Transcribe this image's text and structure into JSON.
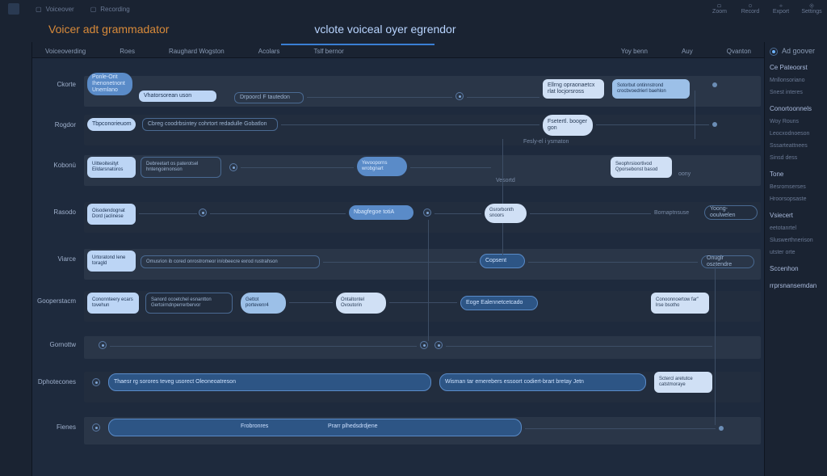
{
  "topbar": {
    "tabs": [
      "Voiceover",
      "Recording"
    ],
    "right_tools": [
      "Zoom",
      "Record",
      "Export",
      "Settings"
    ]
  },
  "titles": {
    "main": "Voicer adt grammadator",
    "sub": "vclote voiceal oyer egrendor"
  },
  "tabs": {
    "items": [
      "Voiceoverding",
      "Roes",
      "Raughard Wogston",
      "Acolars",
      "Tslf bernor"
    ],
    "right_items": [
      "Yoy benn",
      "Auy"
    ],
    "far_right": "Qvanton"
  },
  "row_labels": [
    "Ckorte",
    "Rogdor",
    "Kobonù",
    "Rasodo",
    "Viarce",
    "Gooperstacm",
    "Gornottw",
    "Dphotecones",
    "Fienes"
  ],
  "nodes": {
    "r0": {
      "a": "Ponle-Orit Ihenonetnont Unemlano",
      "b": "Vhatorsorean uson",
      "c": "Drpoorcl F tautedon",
      "d": "Ellrng opraonaetcx rlat locjorsross",
      "e": "Sotorbut ontinnstrond crocbvoedrierl baehlon"
    },
    "r1": {
      "a": "Tbpconorieuom",
      "b": "Cbreg coodrbsintey cohrtort redadulle Gobatlon",
      "c": "Fsetertl. booger gon",
      "d": "Fesly-el i ysmaton"
    },
    "r2": {
      "a": "Uitteoitesityt Eildarsnatoros",
      "b": "Debreetart os paterotsel hntengoirnonson",
      "c": "Yevooporns wrobgnart",
      "d": "Vesortd",
      "e": "Seophrsioortivod Qporsebonst basod",
      "f": "oony"
    },
    "r3": {
      "a": "Oisodendognat Dord (aclinese",
      "b": "Nbagfegoe totiA",
      "c": "Gsrorbonth snoors",
      "d": "Bornaptnsuse",
      "e": "Yoong-ooulwelen"
    },
    "r4": {
      "a": "Urtoratond lene toragld",
      "b": "Omusrion ib cored onrostromeor in/obeecre exrod rustrahson",
      "c": "Copsent",
      "d": "Onuglr osatendre"
    },
    "r5": {
      "a": "Cononnteery ecars tovehun",
      "b": "Sanord ocoetchel esnantton Gertoirndnperrerbervor",
      "c": "Gettot portevenr4",
      "d": "Ontaltontel Ovoutorin",
      "e": "Eoge Ealennetcetcado",
      "f": "Conoonnoertow far\" lrse bsotho"
    },
    "r7": {
      "a": "Thaesr rg sorores teveg usorect Oleoneoatreson",
      "b": "Wisman tar emerebers essoort codiert-brart bretay Jetn",
      "c": "Sctercl aretutce catstmoraye"
    },
    "r8": {
      "a": "Frobronres",
      "b": "Prarr plhedsdrdjene"
    }
  },
  "right_panel": {
    "top_toggle": "Ad goover",
    "sections": [
      {
        "title": "Ce Pateoorst",
        "items": [
          "Mnllonsoriano",
          "Snest interes"
        ]
      },
      {
        "title": "Conortoonnels",
        "items": [
          "Woy Rouns",
          "Leocxodnoeson",
          "Sssarteattnees",
          "Sinsd dess"
        ]
      },
      {
        "title": "Tone",
        "items": [
          "Besromserses",
          "Hroorsopsaste"
        ]
      },
      {
        "title": "Vsiecert",
        "items": [
          "eetotanrtel",
          "Sluswerthnerison",
          "utster orte"
        ]
      },
      {
        "title": "Sccenhon",
        "items": []
      },
      {
        "title": "rrprsnansemdan",
        "items": []
      }
    ]
  }
}
